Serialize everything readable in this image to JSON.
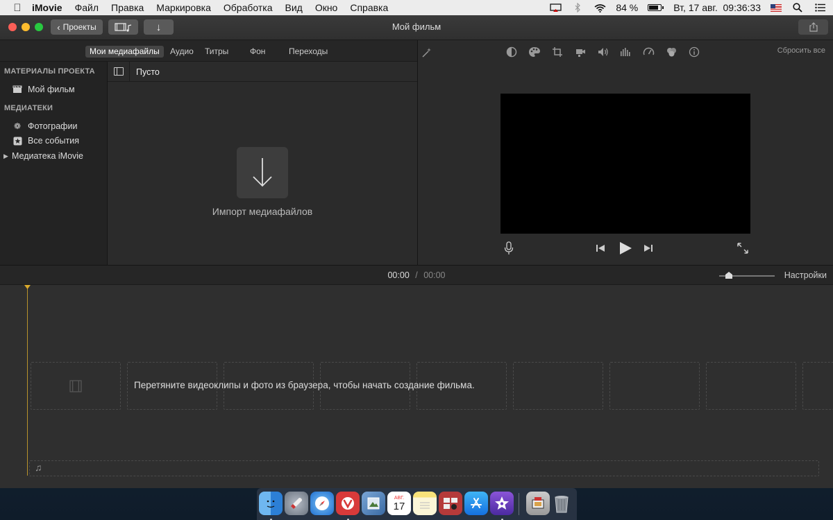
{
  "menubar": {
    "app_name": "iMovie",
    "items": [
      "Файл",
      "Правка",
      "Маркировка",
      "Обработка",
      "Вид",
      "Окно",
      "Справка"
    ],
    "battery_percent": "84 %",
    "battery_level": 0.84,
    "datetime": "Вт, 17 авг.  09:36:33"
  },
  "titlebar": {
    "title": "Мой фильм",
    "projects_label": "Проекты"
  },
  "browser_tabs": [
    "Мои медиафайлы",
    "Аудио",
    "Титры",
    "Фон",
    "Переходы"
  ],
  "sidebar": {
    "project_heading": "МАТЕРИАЛЫ ПРОЕКТА",
    "project_item": "Мой фильм",
    "libraries_heading": "МЕДИАТЕКИ",
    "photos_item": "Фотографии",
    "events_item": "Все события",
    "library_item": "Медиатека iMovie"
  },
  "media": {
    "title": "Пусто",
    "import_label": "Импорт медиафайлов"
  },
  "viewer": {
    "reset_label": "Сбросить все"
  },
  "timeline": {
    "current_time": "00:00",
    "separator": "/",
    "total_time": "00:00",
    "settings_label": "Настройки",
    "drop_hint": "Перетяните видеоклипы и фото из браузера, чтобы начать создание фильма."
  },
  "dock": {
    "calendar_month": "АВГ.",
    "calendar_day": "17"
  },
  "colors": {
    "playhead": "#d9a92c",
    "close": "#fc5f57",
    "minimize": "#fdbc2e",
    "maximize": "#28c840"
  }
}
